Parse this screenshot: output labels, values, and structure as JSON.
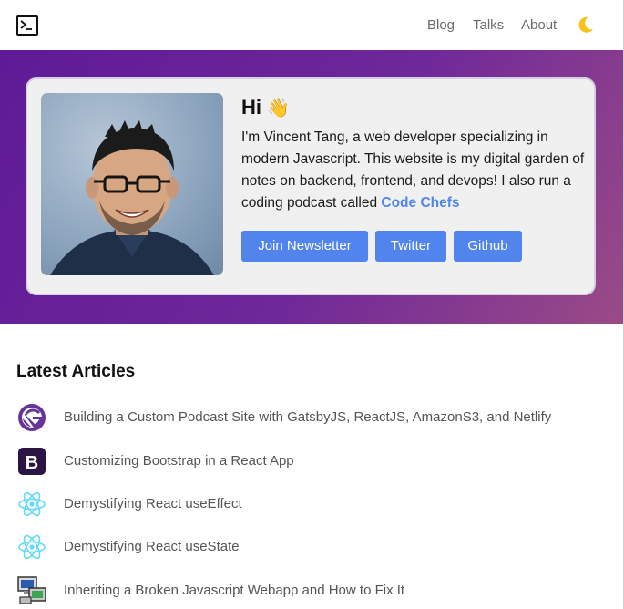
{
  "header": {
    "nav": [
      "Blog",
      "Talks",
      "About"
    ],
    "logo_icon": "terminal-icon",
    "theme_icon": "moon-icon"
  },
  "hero": {
    "greeting": "Hi",
    "wave": "👋",
    "bio_text": "I'm Vincent Tang, a web developer specializing in modern Javascript. This website is my digital garden of notes on backend, frontend, and devops! I also run a coding podcast called",
    "podcast_link": "Code Chefs",
    "buttons": [
      "Join Newsletter",
      "Twitter",
      "Github"
    ]
  },
  "articles": {
    "heading": "Latest Articles",
    "items": [
      {
        "title": "Building a Custom Podcast Site with GatsbyJS, ReactJS, AmazonS3, and Netlify",
        "icon": "gatsby-icon"
      },
      {
        "title": "Customizing Bootstrap in a React App",
        "icon": "bootstrap-icon"
      },
      {
        "title": "Demystifying React useEffect",
        "icon": "react-icon"
      },
      {
        "title": "Demystifying React useState",
        "icon": "react-icon"
      },
      {
        "title": "Inheriting a Broken Javascript Webapp and How to Fix It",
        "icon": "computer-icon"
      }
    ]
  },
  "colors": {
    "accent": "#5284ee",
    "hero_gradient_start": "#5f1a97",
    "hero_gradient_end": "#9a4b86",
    "link": "#4f86e8"
  }
}
